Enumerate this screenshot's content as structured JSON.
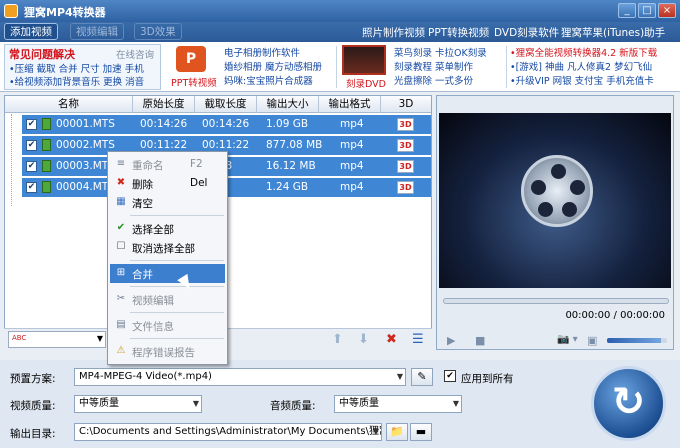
{
  "app": {
    "title": "狸窝MP4转换器"
  },
  "window_controls": {
    "minimize": "_",
    "maximize": "□",
    "close": "×"
  },
  "menu": {
    "tabs": [
      "添加视频",
      "视频编辑",
      "3D效果"
    ],
    "links": [
      "照片制作视频",
      "PPT转换视频",
      "DVD刻录软件",
      "狸窝苹果(iTunes)助手"
    ]
  },
  "faq": {
    "title": "常见问题解决",
    "online": "在线咨询",
    "line1": "•压缩 截取 合并 尺寸 加速 手机",
    "line2": "•给视频添加背景音乐 更换 消音"
  },
  "banner": {
    "ppt_caption": "PPT转视频",
    "ppt_icon": "P",
    "col1": [
      "电子相册制作软件",
      "婚纱相册 魔方动感相册",
      "妈咪:宝宝照片合成器"
    ],
    "dvd_caption": "刻录DVD",
    "col2": [
      "菜鸟刻录 卡拉OK刻录",
      "刻录教程 菜单制作",
      "光盘擦除 一式多份"
    ],
    "col3": [
      "•狸窝全能视频转换器4.2 新版下载",
      "•[游戏] 神曲 凡人修真2 梦幻飞仙",
      "•升级VIP 网银 支付宝 手机充值卡"
    ]
  },
  "table": {
    "headers": [
      "名称",
      "原始长度",
      "截取长度",
      "输出大小",
      "输出格式",
      "3D"
    ],
    "rows": [
      {
        "name": "00001.MTS",
        "orig": "00:14:26",
        "cut": "00:14:26",
        "size": "1.09 GB",
        "format": "mp4",
        "d3": "3D"
      },
      {
        "name": "00002.MTS",
        "orig": "00:11:22",
        "cut": "00:11:22",
        "size": "877.08 MB",
        "format": "mp4",
        "d3": "3D"
      },
      {
        "name": "00003.MTS",
        "orig": "",
        "cut": "00:13",
        "size": "16.12 MB",
        "format": "mp4",
        "d3": "3D"
      },
      {
        "name": "00004.MTS",
        "orig": "",
        "cut": ":31",
        "size": "1.24 GB",
        "format": "mp4",
        "d3": "3D"
      }
    ]
  },
  "list_toolbar": {
    "subtitle_icon": "ABC",
    "dropdown_arrow": "▼",
    "up": "⬆",
    "down": "⬇",
    "delete": "✖",
    "clear": "☰"
  },
  "context_menu": [
    {
      "label": "重命名",
      "shortcut": "F2",
      "icon": "≡",
      "disabled": true
    },
    {
      "label": "删除",
      "shortcut": "Del",
      "icon": "✖",
      "disabled": false
    },
    {
      "label": "清空",
      "shortcut": "",
      "icon": "▦",
      "disabled": false
    },
    {
      "label": "选择全部",
      "shortcut": "",
      "icon": "✔",
      "disabled": false
    },
    {
      "label": "取消选择全部",
      "shortcut": "",
      "icon": "☐",
      "disabled": false
    },
    {
      "label": "合并",
      "shortcut": "",
      "icon": "⊞",
      "disabled": false,
      "highlight": true
    },
    {
      "label": "视频编辑",
      "shortcut": "",
      "icon": "✂",
      "disabled": true
    },
    {
      "label": "文件信息",
      "shortcut": "",
      "icon": "▤",
      "disabled": true
    },
    {
      "label": "程序错误报告",
      "shortcut": "",
      "icon": "⚠",
      "disabled": true
    }
  ],
  "player": {
    "time": "00:00:00 / 00:00:00",
    "play": "▶",
    "stop": "■",
    "camera": "📷 ▾",
    "folder": "▣",
    "volume_level": 0.9
  },
  "bottom": {
    "preset_label": "预置方案:",
    "preset_value": "MP4-MPEG-4 Video(*.mp4)",
    "apply_all": "应用到所有",
    "video_quality_label": "视频质量:",
    "video_quality": "中等质量",
    "audio_quality_label": "音频质量:",
    "audio_quality": "中等质量",
    "output_label": "输出目录:",
    "output_path": "C:\\Documents and Settings\\Administrator\\My Documents\\狸窝\\",
    "convert_icon": "↻"
  },
  "colors": {
    "accent": "#3f86d4",
    "titlebar": "#2e62a3",
    "link": "#1549a3",
    "red": "#d4141c"
  }
}
